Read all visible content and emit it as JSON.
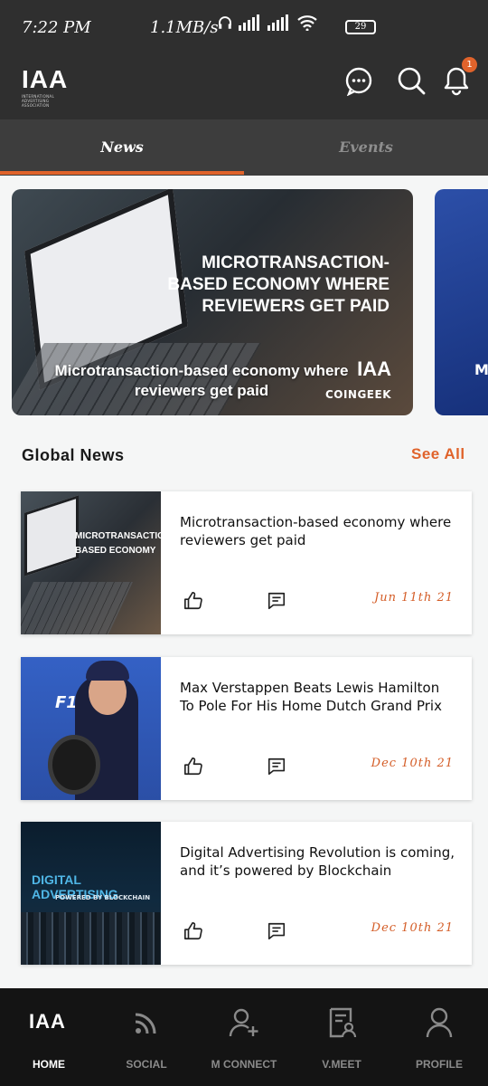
{
  "status_bar": {
    "time": "7:22 PM",
    "network_speed": "1.1MB/s",
    "battery": "29"
  },
  "header": {
    "logo_text": "IAA",
    "logo_subtitle": "INTERNATIONAL ADVERTISING ASSOCIATION",
    "notification_count": "1",
    "icons": [
      "chat-icon",
      "search-icon",
      "bell-icon"
    ]
  },
  "tabs": [
    {
      "label": "News",
      "active": true
    },
    {
      "label": "Events",
      "active": false
    }
  ],
  "accent_color": "#e0632b",
  "carousel": {
    "slides": [
      {
        "overlay_title": "MICROTRANSACTION-BASED ECONOMY WHERE REVIEWERS GET PAID",
        "caption": "Microtransaction-based economy where reviewers get paid",
        "watermark_logo": "IAA",
        "watermark_text": "COINGEEK"
      },
      {
        "peek_text": "M"
      }
    ]
  },
  "global_news": {
    "title": "Global News",
    "see_all": "See All",
    "items": [
      {
        "thumb_text": "MICROTRANSACTION-BASED ECONOMY WHERE REVIEWERS",
        "title": "Microtransaction-based economy where reviewers get paid",
        "date": "Jun 11th 21"
      },
      {
        "thumb_text": "F1",
        "title": "Max Verstappen Beats Lewis Hamilton To Pole For His Home Dutch Grand Prix",
        "date": "Dec 10th 21"
      },
      {
        "thumb_text": "DIGITAL ADVERTISING",
        "thumb_subtext": "POWERED BY BLOCKCHAIN",
        "title": "Digital Advertising Revolution is coming, and it’s powered by Blockchain",
        "date": "Dec 10th 21"
      }
    ]
  },
  "bottom_nav": [
    {
      "label": "HOME",
      "icon": "iaa-logo-icon",
      "logo_text": "IAA",
      "active": true
    },
    {
      "label": "SOCIAL",
      "icon": "rss-icon",
      "active": false
    },
    {
      "label": "M CONNECT",
      "icon": "add-user-icon",
      "active": false
    },
    {
      "label": "V.MEET",
      "icon": "document-user-icon",
      "active": false
    },
    {
      "label": "PROFILE",
      "icon": "user-icon",
      "active": false
    }
  ]
}
